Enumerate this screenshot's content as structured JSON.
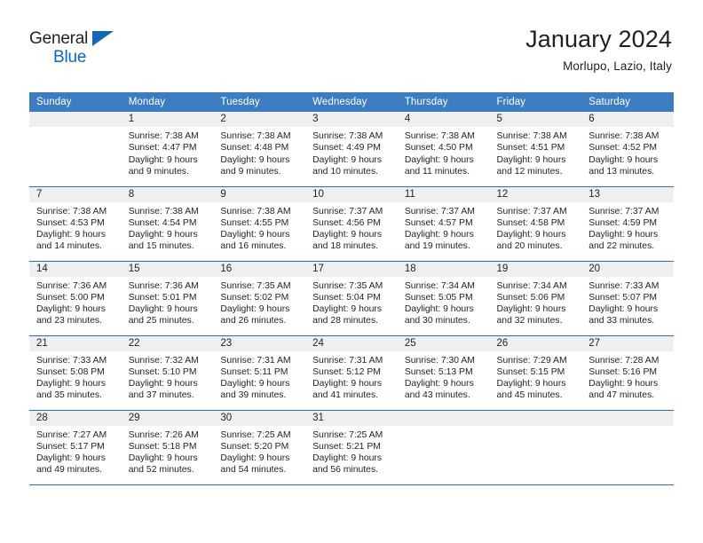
{
  "brand": {
    "name_part1": "General",
    "name_part2": "Blue",
    "logo_icon": "triangle-flag-icon"
  },
  "header": {
    "title": "January 2024",
    "subtitle": "Morlupo, Lazio, Italy"
  },
  "calendar": {
    "weekday_headers": [
      "Sunday",
      "Monday",
      "Tuesday",
      "Wednesday",
      "Thursday",
      "Friday",
      "Saturday"
    ],
    "accent_color": "#3b7dc0",
    "grid_line_color": "#2e6eaf",
    "daynum_bg_color": "#efefef",
    "weeks": [
      [
        {
          "day": "",
          "lines": []
        },
        {
          "day": "1",
          "lines": [
            "Sunrise: 7:38 AM",
            "Sunset: 4:47 PM",
            "Daylight: 9 hours",
            "and 9 minutes."
          ]
        },
        {
          "day": "2",
          "lines": [
            "Sunrise: 7:38 AM",
            "Sunset: 4:48 PM",
            "Daylight: 9 hours",
            "and 9 minutes."
          ]
        },
        {
          "day": "3",
          "lines": [
            "Sunrise: 7:38 AM",
            "Sunset: 4:49 PM",
            "Daylight: 9 hours",
            "and 10 minutes."
          ]
        },
        {
          "day": "4",
          "lines": [
            "Sunrise: 7:38 AM",
            "Sunset: 4:50 PM",
            "Daylight: 9 hours",
            "and 11 minutes."
          ]
        },
        {
          "day": "5",
          "lines": [
            "Sunrise: 7:38 AM",
            "Sunset: 4:51 PM",
            "Daylight: 9 hours",
            "and 12 minutes."
          ]
        },
        {
          "day": "6",
          "lines": [
            "Sunrise: 7:38 AM",
            "Sunset: 4:52 PM",
            "Daylight: 9 hours",
            "and 13 minutes."
          ]
        }
      ],
      [
        {
          "day": "7",
          "lines": [
            "Sunrise: 7:38 AM",
            "Sunset: 4:53 PM",
            "Daylight: 9 hours",
            "and 14 minutes."
          ]
        },
        {
          "day": "8",
          "lines": [
            "Sunrise: 7:38 AM",
            "Sunset: 4:54 PM",
            "Daylight: 9 hours",
            "and 15 minutes."
          ]
        },
        {
          "day": "9",
          "lines": [
            "Sunrise: 7:38 AM",
            "Sunset: 4:55 PM",
            "Daylight: 9 hours",
            "and 16 minutes."
          ]
        },
        {
          "day": "10",
          "lines": [
            "Sunrise: 7:37 AM",
            "Sunset: 4:56 PM",
            "Daylight: 9 hours",
            "and 18 minutes."
          ]
        },
        {
          "day": "11",
          "lines": [
            "Sunrise: 7:37 AM",
            "Sunset: 4:57 PM",
            "Daylight: 9 hours",
            "and 19 minutes."
          ]
        },
        {
          "day": "12",
          "lines": [
            "Sunrise: 7:37 AM",
            "Sunset: 4:58 PM",
            "Daylight: 9 hours",
            "and 20 minutes."
          ]
        },
        {
          "day": "13",
          "lines": [
            "Sunrise: 7:37 AM",
            "Sunset: 4:59 PM",
            "Daylight: 9 hours",
            "and 22 minutes."
          ]
        }
      ],
      [
        {
          "day": "14",
          "lines": [
            "Sunrise: 7:36 AM",
            "Sunset: 5:00 PM",
            "Daylight: 9 hours",
            "and 23 minutes."
          ]
        },
        {
          "day": "15",
          "lines": [
            "Sunrise: 7:36 AM",
            "Sunset: 5:01 PM",
            "Daylight: 9 hours",
            "and 25 minutes."
          ]
        },
        {
          "day": "16",
          "lines": [
            "Sunrise: 7:35 AM",
            "Sunset: 5:02 PM",
            "Daylight: 9 hours",
            "and 26 minutes."
          ]
        },
        {
          "day": "17",
          "lines": [
            "Sunrise: 7:35 AM",
            "Sunset: 5:04 PM",
            "Daylight: 9 hours",
            "and 28 minutes."
          ]
        },
        {
          "day": "18",
          "lines": [
            "Sunrise: 7:34 AM",
            "Sunset: 5:05 PM",
            "Daylight: 9 hours",
            "and 30 minutes."
          ]
        },
        {
          "day": "19",
          "lines": [
            "Sunrise: 7:34 AM",
            "Sunset: 5:06 PM",
            "Daylight: 9 hours",
            "and 32 minutes."
          ]
        },
        {
          "day": "20",
          "lines": [
            "Sunrise: 7:33 AM",
            "Sunset: 5:07 PM",
            "Daylight: 9 hours",
            "and 33 minutes."
          ]
        }
      ],
      [
        {
          "day": "21",
          "lines": [
            "Sunrise: 7:33 AM",
            "Sunset: 5:08 PM",
            "Daylight: 9 hours",
            "and 35 minutes."
          ]
        },
        {
          "day": "22",
          "lines": [
            "Sunrise: 7:32 AM",
            "Sunset: 5:10 PM",
            "Daylight: 9 hours",
            "and 37 minutes."
          ]
        },
        {
          "day": "23",
          "lines": [
            "Sunrise: 7:31 AM",
            "Sunset: 5:11 PM",
            "Daylight: 9 hours",
            "and 39 minutes."
          ]
        },
        {
          "day": "24",
          "lines": [
            "Sunrise: 7:31 AM",
            "Sunset: 5:12 PM",
            "Daylight: 9 hours",
            "and 41 minutes."
          ]
        },
        {
          "day": "25",
          "lines": [
            "Sunrise: 7:30 AM",
            "Sunset: 5:13 PM",
            "Daylight: 9 hours",
            "and 43 minutes."
          ]
        },
        {
          "day": "26",
          "lines": [
            "Sunrise: 7:29 AM",
            "Sunset: 5:15 PM",
            "Daylight: 9 hours",
            "and 45 minutes."
          ]
        },
        {
          "day": "27",
          "lines": [
            "Sunrise: 7:28 AM",
            "Sunset: 5:16 PM",
            "Daylight: 9 hours",
            "and 47 minutes."
          ]
        }
      ],
      [
        {
          "day": "28",
          "lines": [
            "Sunrise: 7:27 AM",
            "Sunset: 5:17 PM",
            "Daylight: 9 hours",
            "and 49 minutes."
          ]
        },
        {
          "day": "29",
          "lines": [
            "Sunrise: 7:26 AM",
            "Sunset: 5:18 PM",
            "Daylight: 9 hours",
            "and 52 minutes."
          ]
        },
        {
          "day": "30",
          "lines": [
            "Sunrise: 7:25 AM",
            "Sunset: 5:20 PM",
            "Daylight: 9 hours",
            "and 54 minutes."
          ]
        },
        {
          "day": "31",
          "lines": [
            "Sunrise: 7:25 AM",
            "Sunset: 5:21 PM",
            "Daylight: 9 hours",
            "and 56 minutes."
          ]
        },
        {
          "day": "",
          "lines": []
        },
        {
          "day": "",
          "lines": []
        },
        {
          "day": "",
          "lines": []
        }
      ]
    ]
  }
}
